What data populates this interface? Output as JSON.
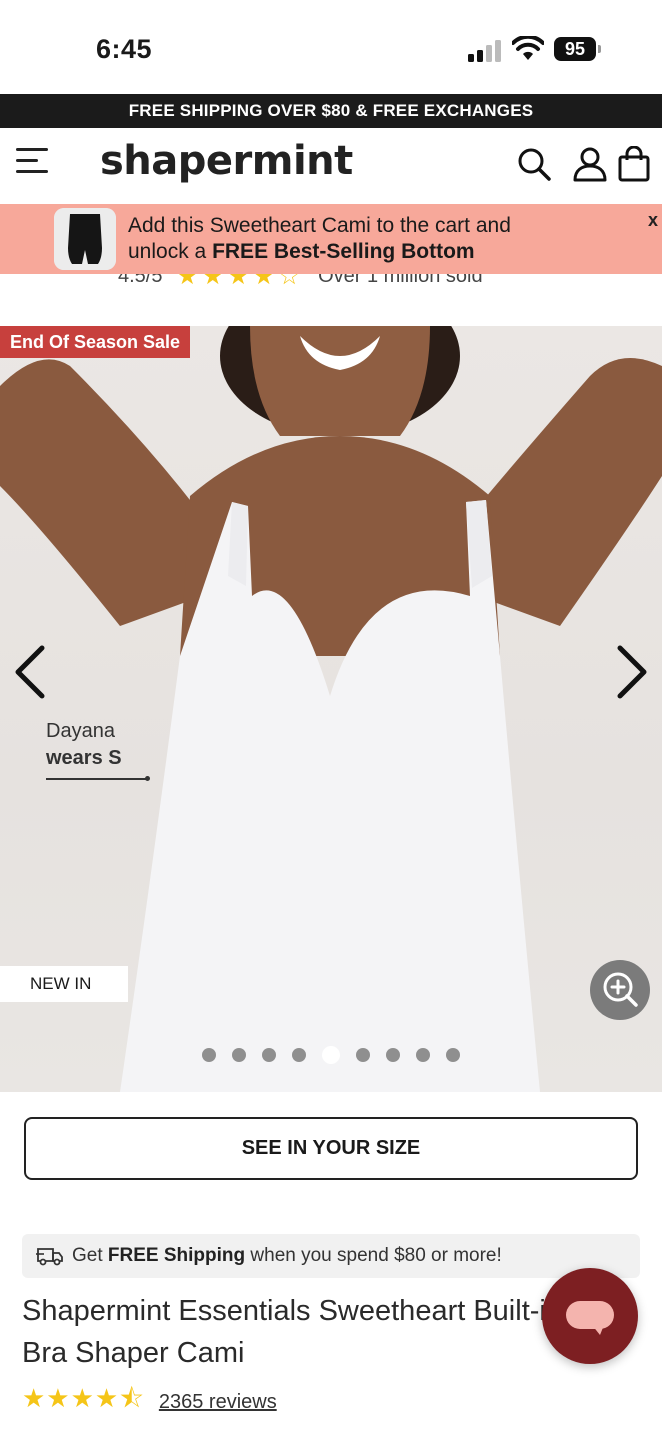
{
  "status_bar": {
    "time": "6:45",
    "battery": "95"
  },
  "promo_bar": {
    "text": "FREE SHIPPING OVER $80 & FREE EXCHANGES"
  },
  "header": {
    "logo": "shapermint"
  },
  "upsell": {
    "line1": "Add this Sweetheart Cami to the cart and",
    "line2_prefix": "unlock a ",
    "line2_bold": "FREE Best-Selling Bottom",
    "close": "x"
  },
  "clipped_rating": {
    "score": "4.5/5",
    "sold": "Over 1 million sold"
  },
  "hero": {
    "sale_badge": "End Of Season Sale",
    "new_badge": "NEW IN",
    "model_name": "Dayana",
    "model_size": "wears S",
    "slide_count": 9,
    "active_slide": 5
  },
  "size_button": {
    "label": "SEE IN YOUR SIZE"
  },
  "shipping_note": {
    "prefix": "Get ",
    "bold": "FREE Shipping",
    "suffix": " when you spend $80 or more!"
  },
  "product": {
    "title": "Shapermint Essentials Sweetheart Built-in Bra Shaper Cami",
    "rating": 4.5,
    "reviews": "2365 reviews"
  },
  "colors": {
    "promo_bg": "#1b1b1b",
    "upsell_bg": "#f7a89a",
    "sale_badge": "#c7403d",
    "star": "#f5c518",
    "chat_bg": "#7d1f22"
  }
}
